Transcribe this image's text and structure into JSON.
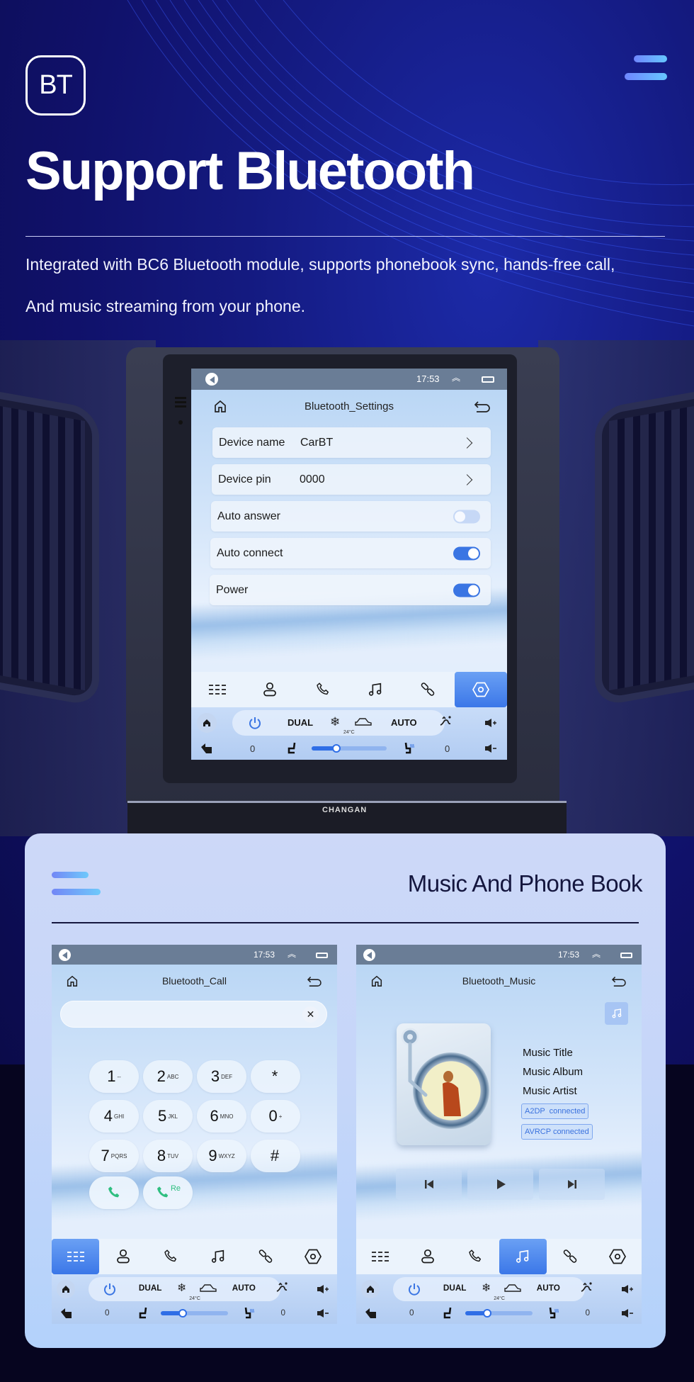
{
  "header": {
    "badge": "BT",
    "title": "Support Bluetooth",
    "description_lines": [
      "Integrated with BC6 Bluetooth module, supports phonebook sync, hands-free call,",
      "And music streaming from your phone."
    ]
  },
  "car": {
    "brand_label": "CHANGAN"
  },
  "status_bar": {
    "time": "17:53"
  },
  "settings_screen": {
    "title": "Bluetooth_Settings",
    "rows": [
      {
        "label": "Device name",
        "value": "CarBT",
        "type": "link"
      },
      {
        "label": "Device pin",
        "value": "0000",
        "type": "link"
      },
      {
        "label": "Auto answer",
        "type": "toggle",
        "on": false
      },
      {
        "label": "Auto connect",
        "type": "toggle",
        "on": true
      },
      {
        "label": "Power",
        "type": "toggle",
        "on": true
      }
    ],
    "active_tab": "settings"
  },
  "nav_tabs": [
    {
      "id": "dialpad",
      "icon": "dialpad-icon"
    },
    {
      "id": "contacts",
      "icon": "contacts-icon"
    },
    {
      "id": "call-log",
      "icon": "phone-icon"
    },
    {
      "id": "music",
      "icon": "music-note-icon"
    },
    {
      "id": "pairing",
      "icon": "link-icon"
    },
    {
      "id": "settings",
      "icon": "settings-hexagon-icon"
    }
  ],
  "climate": {
    "dual_label": "DUAL",
    "auto_label": "AUTO",
    "temperature": "24°C",
    "left_seat_level": "0",
    "right_seat_level": "0",
    "fan_level_fraction": 0.33
  },
  "lower_card": {
    "title": "Music And Phone Book"
  },
  "call_screen": {
    "title": "Bluetooth_Call",
    "search_value": "",
    "keys": [
      {
        "digit": "1",
        "letters": "--"
      },
      {
        "digit": "2",
        "letters": "ABC"
      },
      {
        "digit": "3",
        "letters": "DEF"
      },
      {
        "digit": "*",
        "letters": ""
      },
      {
        "digit": "4",
        "letters": "GHI"
      },
      {
        "digit": "5",
        "letters": "JKL"
      },
      {
        "digit": "6",
        "letters": "MNO"
      },
      {
        "digit": "0",
        "letters": "+"
      },
      {
        "digit": "7",
        "letters": "PQRS"
      },
      {
        "digit": "8",
        "letters": "TUV"
      },
      {
        "digit": "9",
        "letters": "WXYZ"
      },
      {
        "digit": "#",
        "letters": ""
      }
    ],
    "redial_label": "Re",
    "active_tab": "dialpad"
  },
  "music_screen": {
    "title": "Bluetooth_Music",
    "track_title": "Music Title",
    "album": "Music Album",
    "artist": "Music Artist",
    "tags": [
      "A2DP  connected",
      "AVRCP connected"
    ],
    "active_tab": "music"
  },
  "colors": {
    "accent_blue": "#3a75e3",
    "status_bar": "#6a7d96",
    "call_green": "#2fbf80",
    "hero_bg": "#12126a",
    "card_bg": "#c8d6f8"
  }
}
